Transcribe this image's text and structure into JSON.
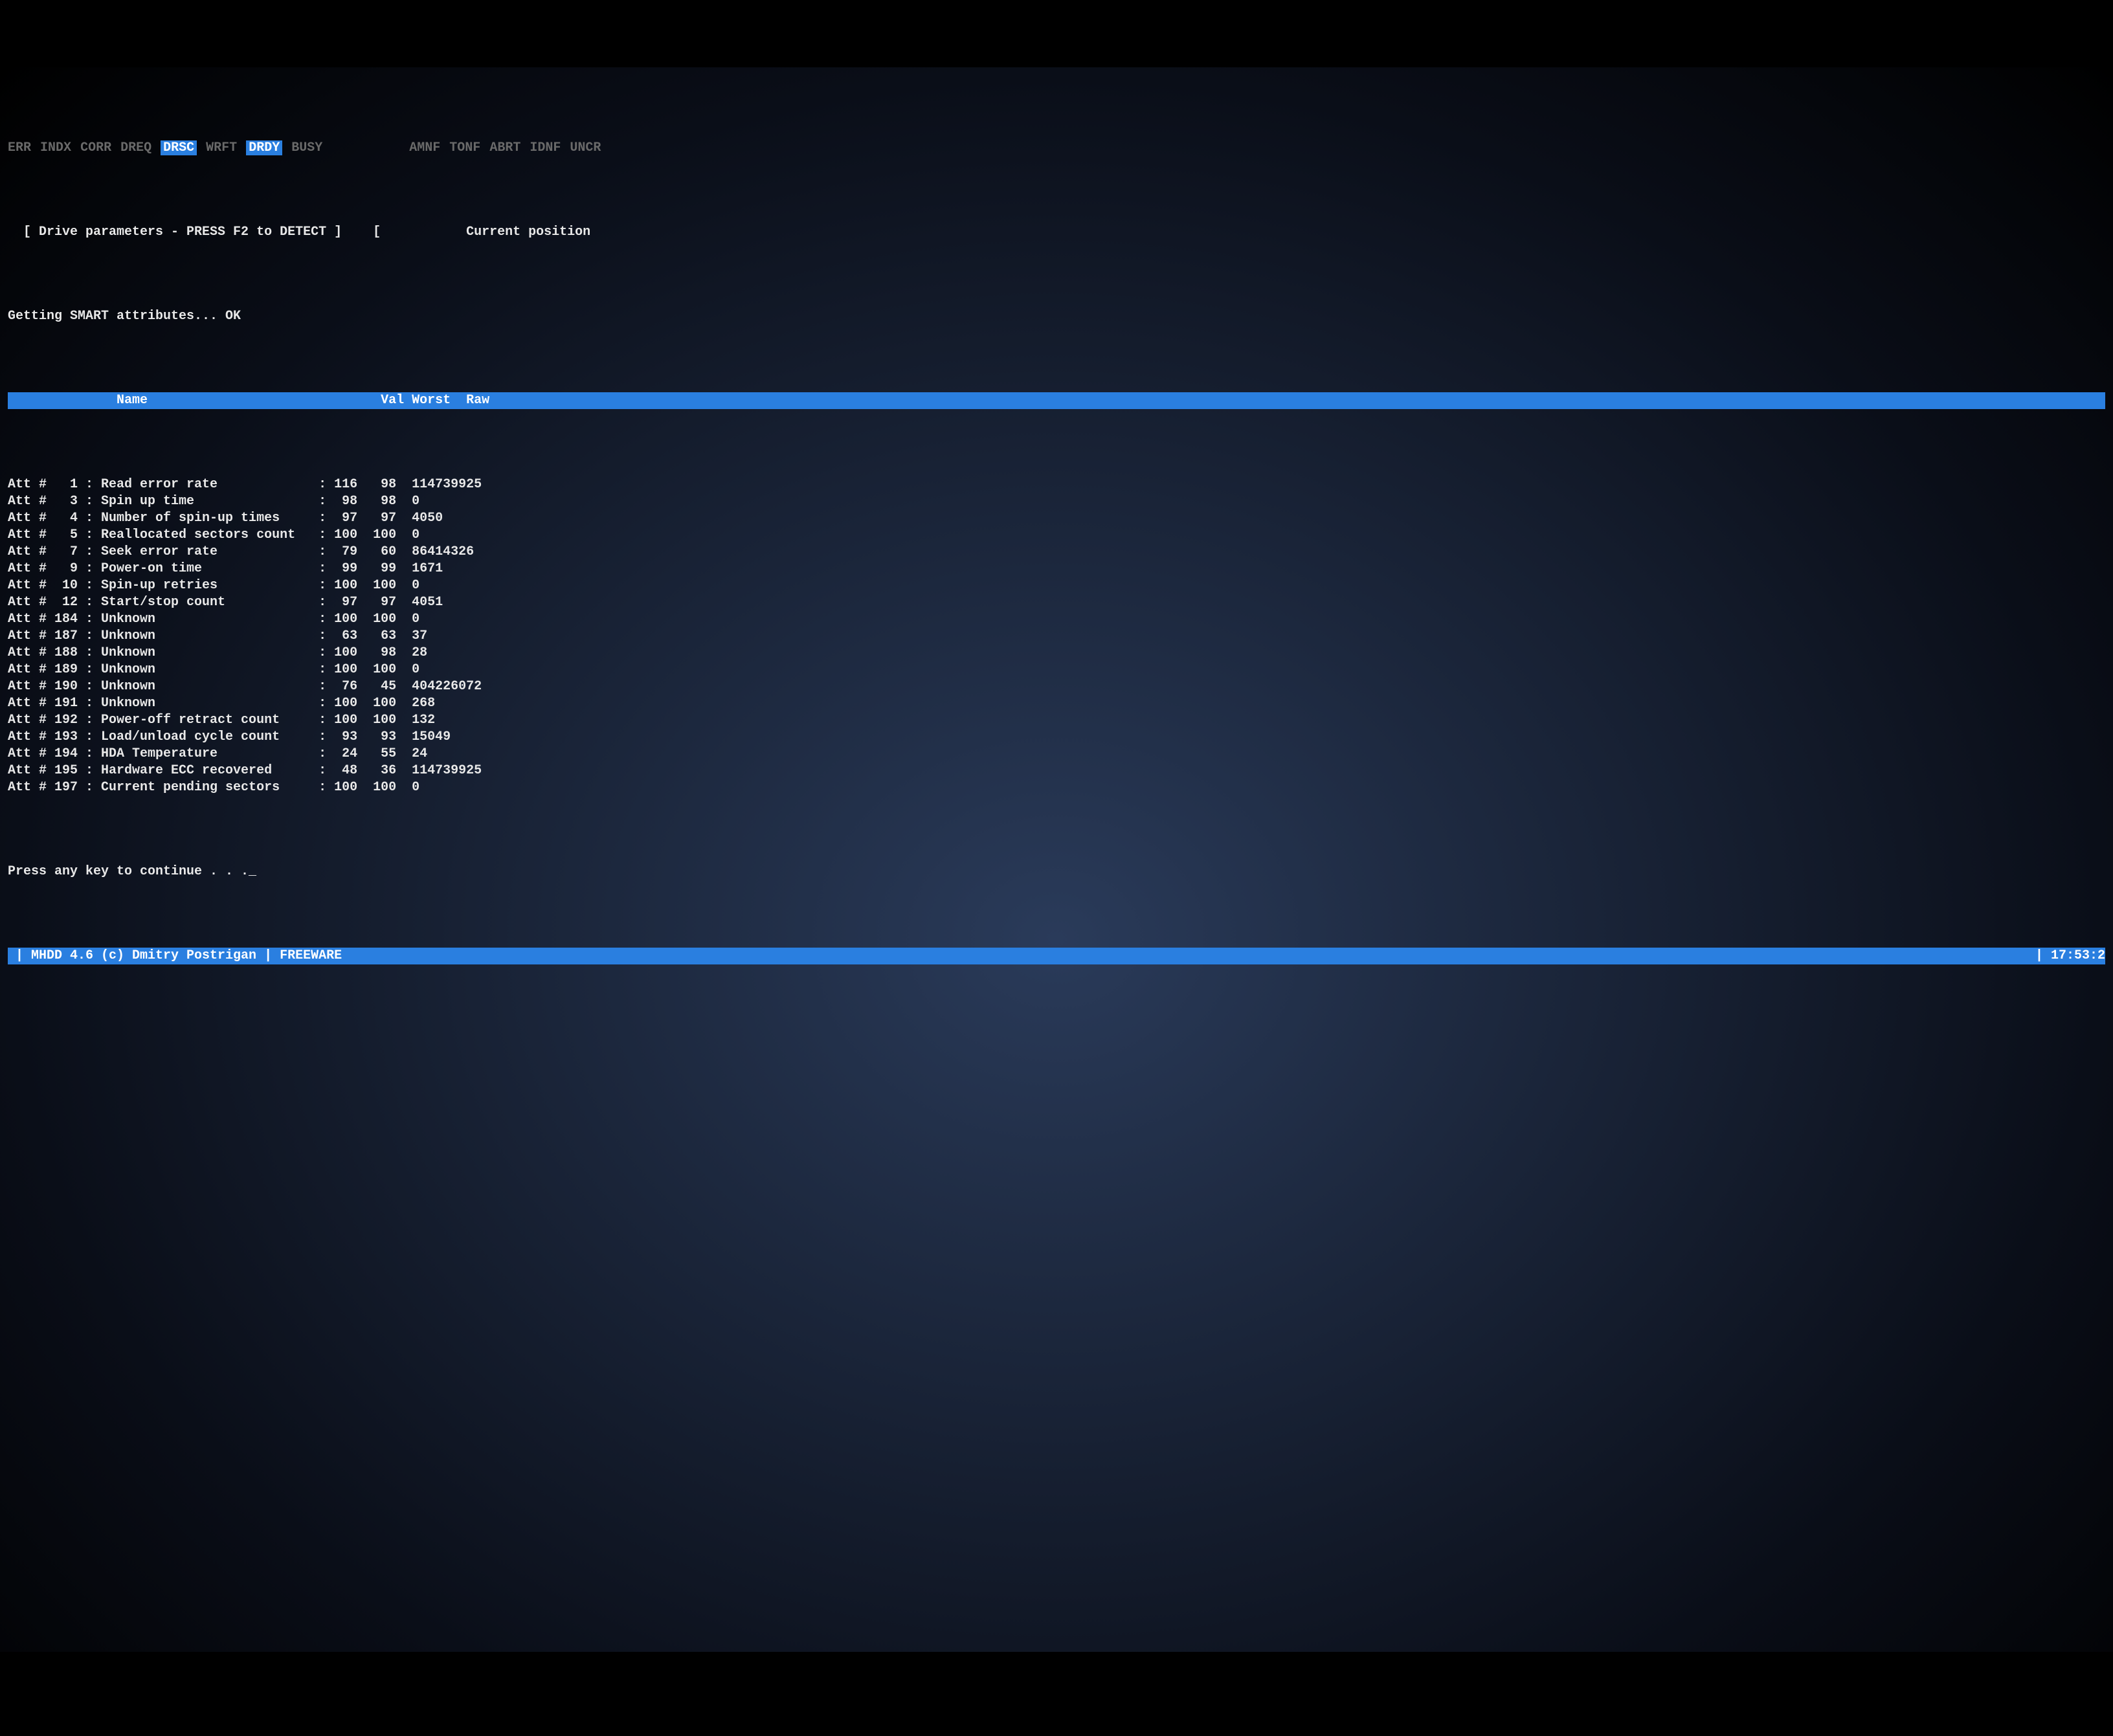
{
  "flags_left_dim": [
    "ERR",
    "INDX",
    "CORR",
    "DREQ"
  ],
  "flags_hilite": [
    "DRSC"
  ],
  "flags_mid_dim": [
    "WRFT"
  ],
  "flags_hilite2": [
    "DRDY"
  ],
  "flags_right_dim": [
    "BUSY"
  ],
  "flags_far_right_dim": [
    "AMNF",
    "TONF",
    "ABRT",
    "IDNF",
    "UNCR"
  ],
  "line_drive_params": "  [ Drive parameters - PRESS F2 to DETECT ]    [",
  "line_current_pos": "Current position",
  "line_getting_smart": "Getting SMART attributes... OK",
  "header_name": "Name",
  "header_val": "Val",
  "header_worst": "Worst",
  "header_raw": "Raw",
  "att_prefix": "Att #",
  "attributes": [
    {
      "id": "1",
      "name": "Read error rate",
      "val": "116",
      "worst": "98",
      "raw": "114739925"
    },
    {
      "id": "3",
      "name": "Spin up time",
      "val": "98",
      "worst": "98",
      "raw": "0"
    },
    {
      "id": "4",
      "name": "Number of spin-up times",
      "val": "97",
      "worst": "97",
      "raw": "4050"
    },
    {
      "id": "5",
      "name": "Reallocated sectors count",
      "val": "100",
      "worst": "100",
      "raw": "0"
    },
    {
      "id": "7",
      "name": "Seek error rate",
      "val": "79",
      "worst": "60",
      "raw": "86414326"
    },
    {
      "id": "9",
      "name": "Power-on time",
      "val": "99",
      "worst": "99",
      "raw": "1671"
    },
    {
      "id": "10",
      "name": "Spin-up retries",
      "val": "100",
      "worst": "100",
      "raw": "0"
    },
    {
      "id": "12",
      "name": "Start/stop count",
      "val": "97",
      "worst": "97",
      "raw": "4051"
    },
    {
      "id": "184",
      "name": "Unknown",
      "val": "100",
      "worst": "100",
      "raw": "0"
    },
    {
      "id": "187",
      "name": "Unknown",
      "val": "63",
      "worst": "63",
      "raw": "37"
    },
    {
      "id": "188",
      "name": "Unknown",
      "val": "100",
      "worst": "98",
      "raw": "28"
    },
    {
      "id": "189",
      "name": "Unknown",
      "val": "100",
      "worst": "100",
      "raw": "0"
    },
    {
      "id": "190",
      "name": "Unknown",
      "val": "76",
      "worst": "45",
      "raw": "404226072"
    },
    {
      "id": "191",
      "name": "Unknown",
      "val": "100",
      "worst": "100",
      "raw": "268"
    },
    {
      "id": "192",
      "name": "Power-off retract count",
      "val": "100",
      "worst": "100",
      "raw": "132"
    },
    {
      "id": "193",
      "name": "Load/unload cycle count",
      "val": "93",
      "worst": "93",
      "raw": "15049"
    },
    {
      "id": "194",
      "name": "HDA Temperature",
      "val": "24",
      "worst": "55",
      "raw": "24"
    },
    {
      "id": "195",
      "name": "Hardware ECC recovered",
      "val": "48",
      "worst": "36",
      "raw": "114739925"
    },
    {
      "id": "197",
      "name": "Current pending sectors",
      "val": "100",
      "worst": "100",
      "raw": "0"
    }
  ],
  "press_any_key": "Press any key to continue . . ._",
  "footer_left": " | MHDD 4.6 (c) Dmitry Postrigan | FREEWARE",
  "footer_right": "| 17:53:2"
}
